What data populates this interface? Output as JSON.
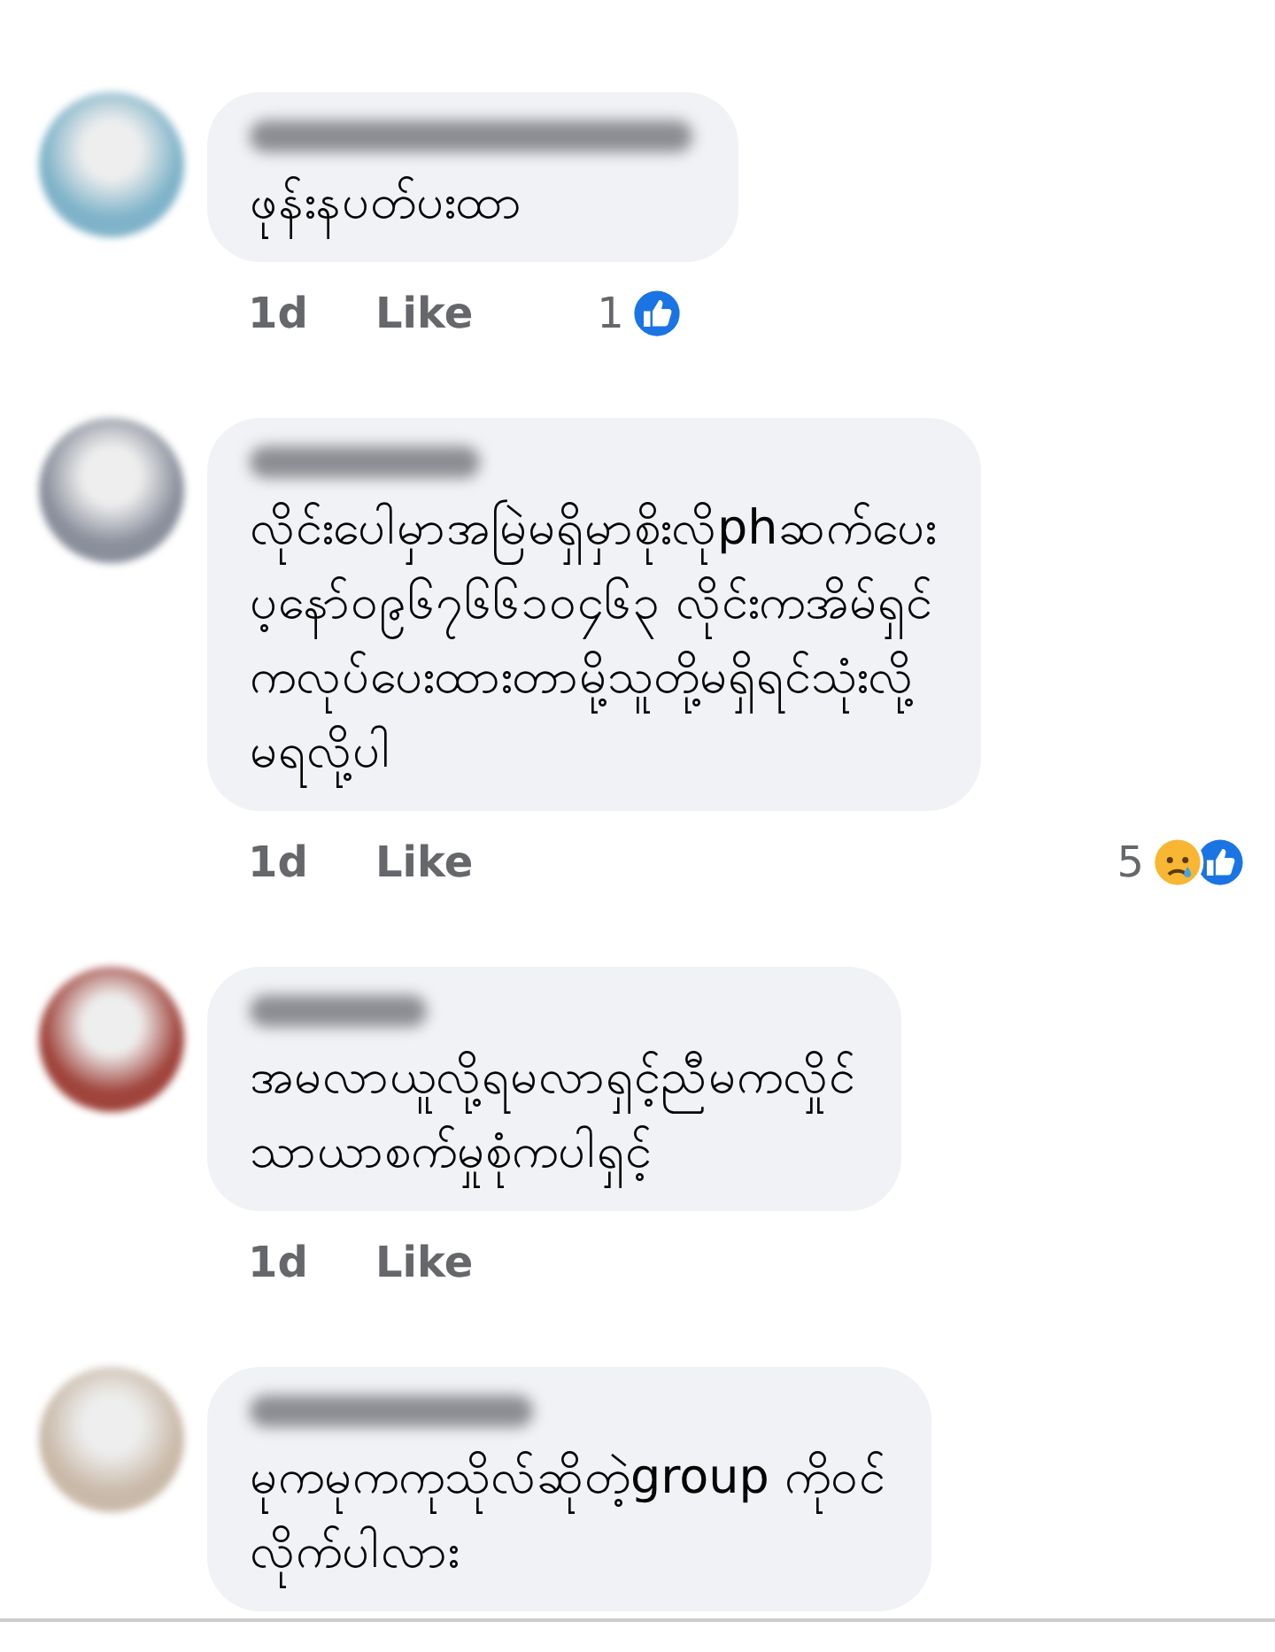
{
  "comments": [
    {
      "text": "ဖုန်းနပတ်ပးထာ",
      "time": "1d",
      "like": "Like",
      "reactions": {
        "count": "1",
        "icons": [
          {
            "kind": "like"
          }
        ]
      }
    },
    {
      "text": "လိုင်းပေါမှာအမြဲမရှိမှာစိုးလိုphဆက်ပေး\nပ့နော်၀၉၆၇၆၆၁၀၄၆၃ လိုင်းကအိမ်ရှင်\nကလုပ်ပေးထားတာမို့သူတို့မရှိရင်သုံးလို့\nမရလို့ပါ",
      "time": "1d",
      "like": "Like",
      "reactions": {
        "count": "5",
        "icons": [
          {
            "kind": "sad"
          },
          {
            "kind": "like"
          }
        ]
      }
    },
    {
      "text": "အမလာယူလို့ရမလာရှင့်ညီမကလှိုင်\nသာယာစက်မှုစုံကပါရှင့်",
      "time": "1d",
      "like": "Like"
    },
    {
      "text": "မုကမုကကုသိုလ်ဆိုတဲ့group ကိုဝင်\nလိုက်ပါလား"
    }
  ]
}
